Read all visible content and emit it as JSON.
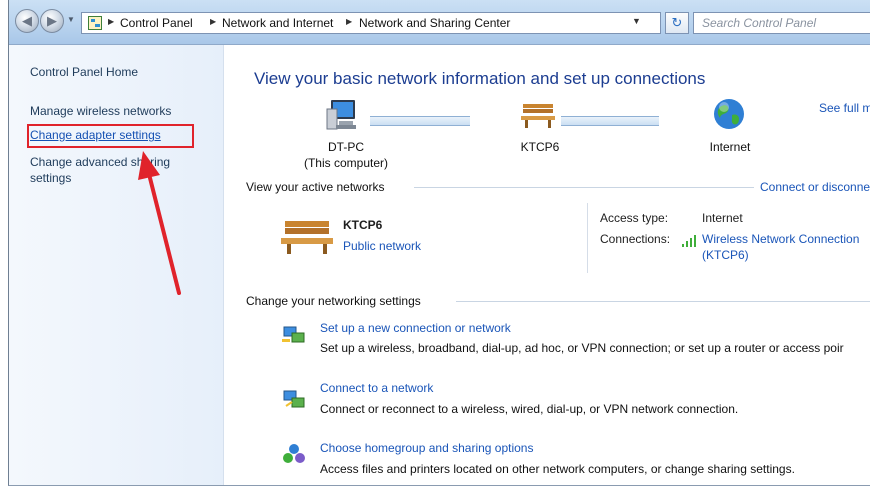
{
  "nav": {
    "back_glyph": "◀",
    "forward_glyph": "▶",
    "breadcrumb": [
      "Control Panel",
      "Network and Internet",
      "Network and Sharing Center"
    ],
    "search_placeholder": "Search Control Panel"
  },
  "sidebar": {
    "home": "Control Panel Home",
    "items": [
      "Manage wireless networks",
      "Change adapter settings",
      "Change advanced sharing settings"
    ]
  },
  "main": {
    "title": "View your basic network information and set up connections",
    "see_full_map": "See full m",
    "map": {
      "computer_name": "DT-PC",
      "computer_sub": "(This computer)",
      "network_name": "KTCP6",
      "internet": "Internet"
    },
    "active_networks": {
      "header": "View your active networks",
      "connect_link": "Connect or disconne",
      "name": "KTCP6",
      "type": "Public network",
      "access_type_label": "Access type:",
      "access_type_value": "Internet",
      "connections_label": "Connections:",
      "connection_value_line1": "Wireless Network Connection",
      "connection_value_line2": "(KTCP6)"
    },
    "settings": {
      "header": "Change your networking settings",
      "tasks": [
        {
          "title": "Set up a new connection or network",
          "desc": "Set up a wireless, broadband, dial-up, ad hoc, or VPN connection; or set up a router or access poir"
        },
        {
          "title": "Connect to a network",
          "desc": "Connect or reconnect to a wireless, wired, dial-up, or VPN network connection."
        },
        {
          "title": "Choose homegroup and sharing options",
          "desc": "Access files and printers located on other network computers, or change sharing settings."
        }
      ]
    }
  },
  "colors": {
    "link": "#1a55b8",
    "title": "#1c3d91",
    "annotation": "#e0232b"
  },
  "icons": [
    "back-arrow-icon",
    "forward-arrow-icon",
    "network-folder-icon",
    "refresh-icon",
    "computer-icon",
    "bench-icon",
    "globe-icon",
    "signal-bars-icon",
    "network-setup-icon",
    "connect-network-icon",
    "homegroup-icon"
  ]
}
